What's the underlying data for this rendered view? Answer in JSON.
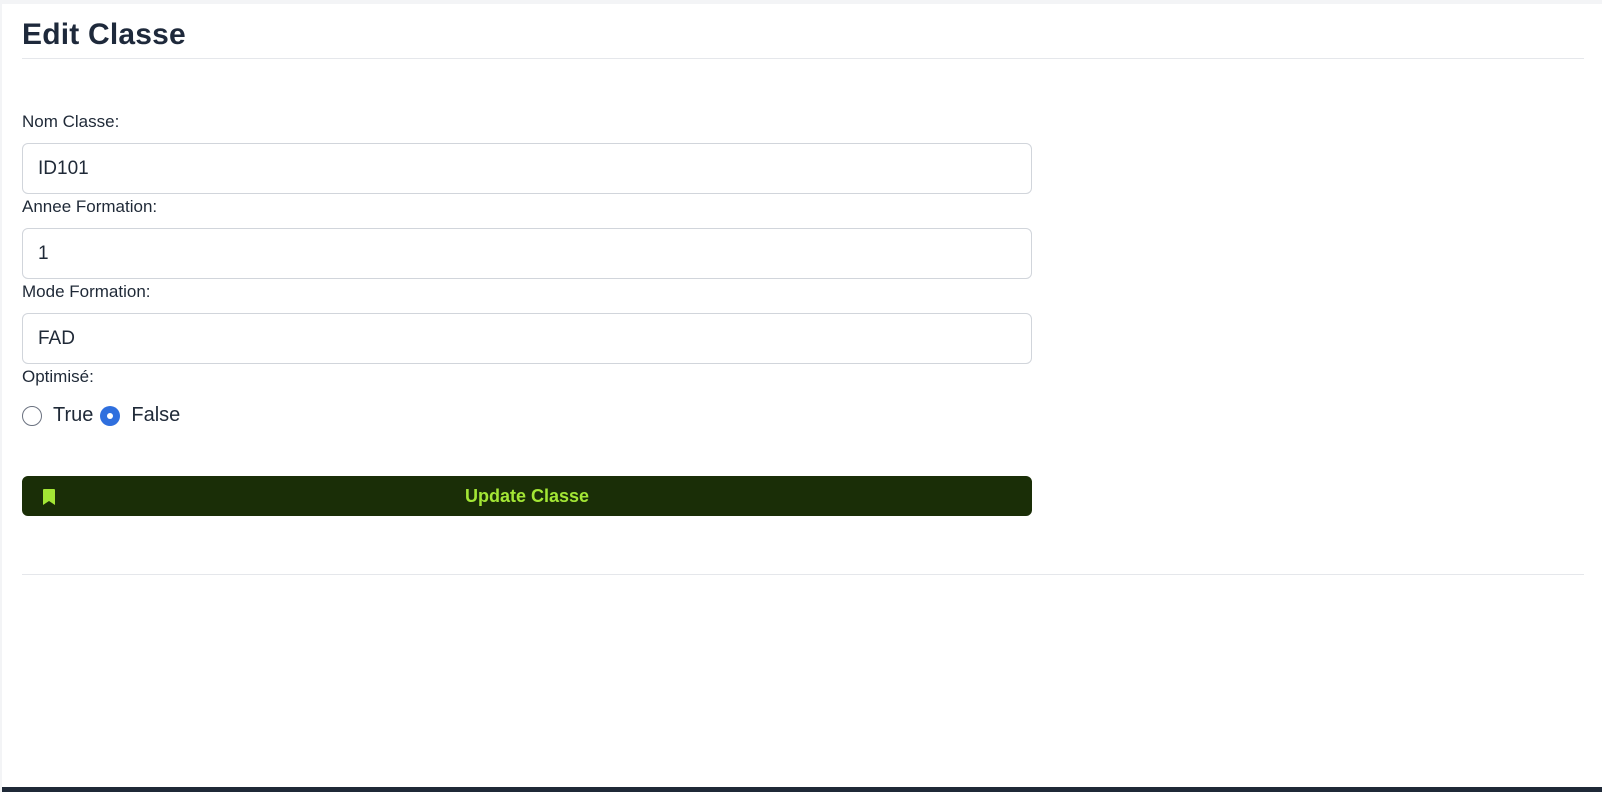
{
  "page": {
    "title": "Edit Classe"
  },
  "form": {
    "nom_classe": {
      "label": "Nom Classe:",
      "value": "ID101"
    },
    "annee_formation": {
      "label": "Annee Formation:",
      "value": "1"
    },
    "mode_formation": {
      "label": "Mode Formation:",
      "value": "FAD"
    },
    "optimise": {
      "label": "Optimisé:",
      "options": [
        {
          "label": "True",
          "checked": false
        },
        {
          "label": "False",
          "checked": true
        }
      ]
    },
    "submit": {
      "label": "Update Classe",
      "icon": "bookmark-icon"
    }
  },
  "colors": {
    "button_bg": "#1a2e07",
    "button_text": "#a3e635",
    "radio_checked": "#2f6fde",
    "title_text": "#1e293b"
  }
}
